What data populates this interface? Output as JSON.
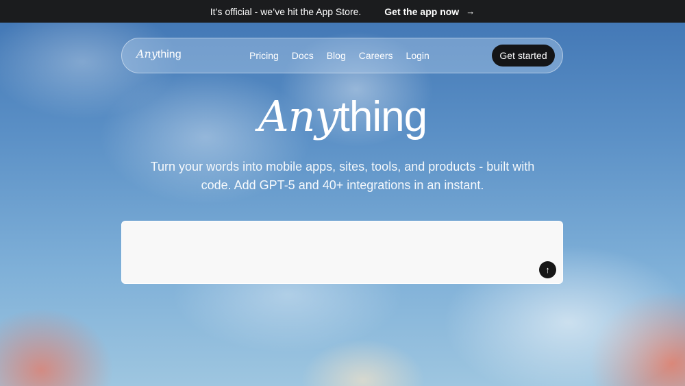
{
  "banner": {
    "message": "It’s official - we’ve hit the App Store.",
    "cta_label": "Get the app now",
    "cta_icon": "arrow-right-icon"
  },
  "nav": {
    "logo_italic": "Any",
    "logo_regular": "thing",
    "links": [
      "Pricing",
      "Docs",
      "Blog",
      "Careers",
      "Login"
    ],
    "cta_label": "Get started"
  },
  "hero": {
    "logo_italic": "Any",
    "logo_regular": "thing",
    "tagline": "Turn your words into mobile apps, sites, tools, and products - built with code. Add GPT-5 and 40+ integrations in an instant."
  },
  "prompt": {
    "value": "",
    "placeholder": "",
    "send_icon": "arrow-up-icon"
  },
  "colors": {
    "banner_bg": "#1b1c1e",
    "button_bg": "#141517",
    "prompt_bg": "#f8f8f8"
  }
}
